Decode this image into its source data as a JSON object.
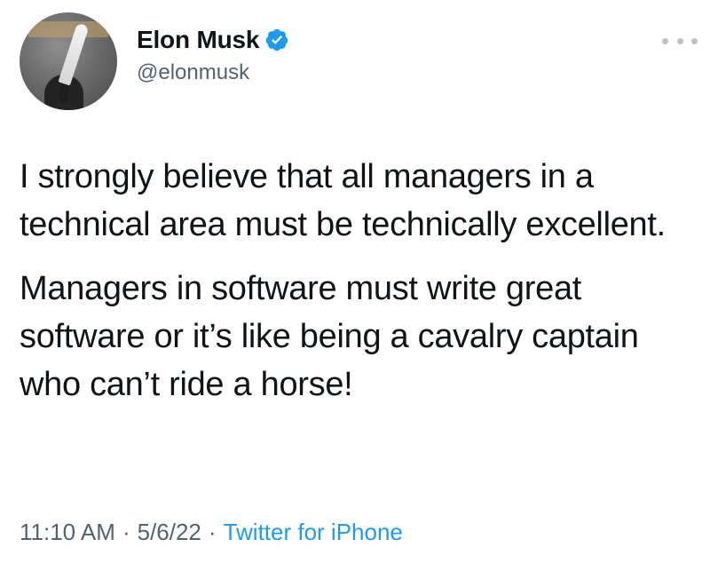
{
  "author": {
    "display_name": "Elon Musk",
    "handle": "@elonmusk",
    "verified_icon": "verified-badge-icon",
    "accent": "#1d9bf0"
  },
  "tweet": {
    "paragraphs": [
      "I strongly believe that all managers in a technical area must be technically excellent.",
      "Managers in software must write great software or it’s like being a cavalry captain who can’t ride a horse!"
    ]
  },
  "meta": {
    "time": "11:10 AM",
    "separator": "·",
    "date": "5/6/22",
    "source": "Twitter for iPhone"
  },
  "more_icon": "more-options-icon"
}
